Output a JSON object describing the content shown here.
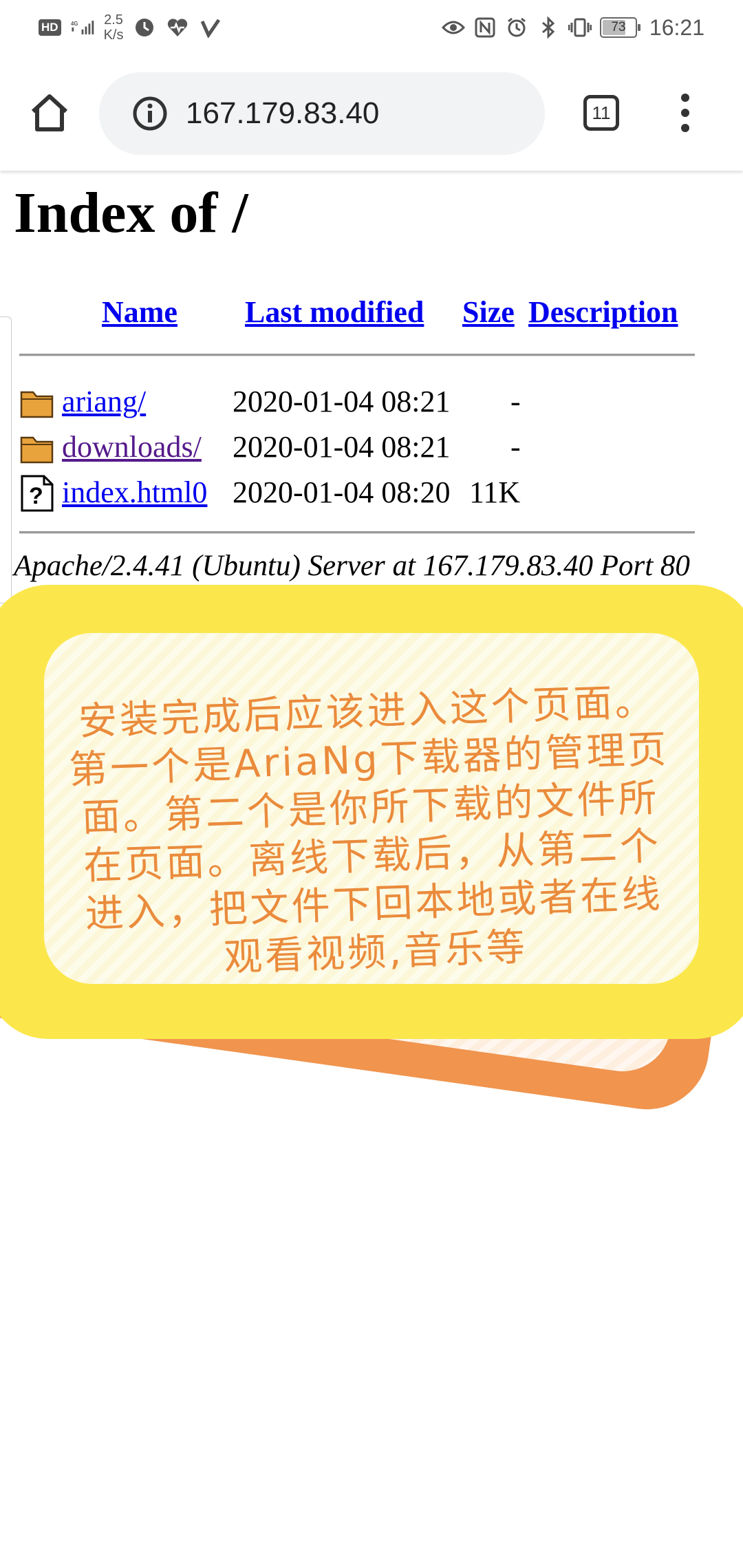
{
  "status_bar": {
    "hd_label": "HD",
    "network_label": "4G",
    "net_speed": "2.5\nK/s",
    "battery_level": "73",
    "time": "16:21"
  },
  "browser": {
    "url": "167.179.83.40",
    "tab_count": "11",
    "icons": [
      "home-icon",
      "info-icon",
      "tab-switcher-icon",
      "menu-icon"
    ]
  },
  "page": {
    "title": "Index of /",
    "columns": {
      "name": "Name",
      "last_modified": "Last modified",
      "size": "Size",
      "description": "Description"
    },
    "rows": [
      {
        "name": "ariang/",
        "modified": "2020-01-04 08:21",
        "size": "-",
        "type": "folder",
        "visited": false
      },
      {
        "name": "downloads/",
        "modified": "2020-01-04 08:21",
        "size": "-",
        "type": "folder",
        "visited": true
      },
      {
        "name": "index.html0",
        "modified": "2020-01-04 08:20",
        "size": "11K",
        "type": "unknown",
        "visited": false
      }
    ],
    "server_signature": "Apache/2.4.41 (Ubuntu) Server at 167.179.83.40 Port 80"
  },
  "overlay_note": {
    "text": "安装完成后应该进入这个页面。第一个是AriaNg下载器的管理页面。第二个是你所下载的文件所在页面。离线下载后，从第二个进入，把文件下回本地或者在线观看视频,音乐等",
    "colors": {
      "text": "#ea8b3c",
      "front": "#fbe74b",
      "back": "#f0944e"
    }
  }
}
